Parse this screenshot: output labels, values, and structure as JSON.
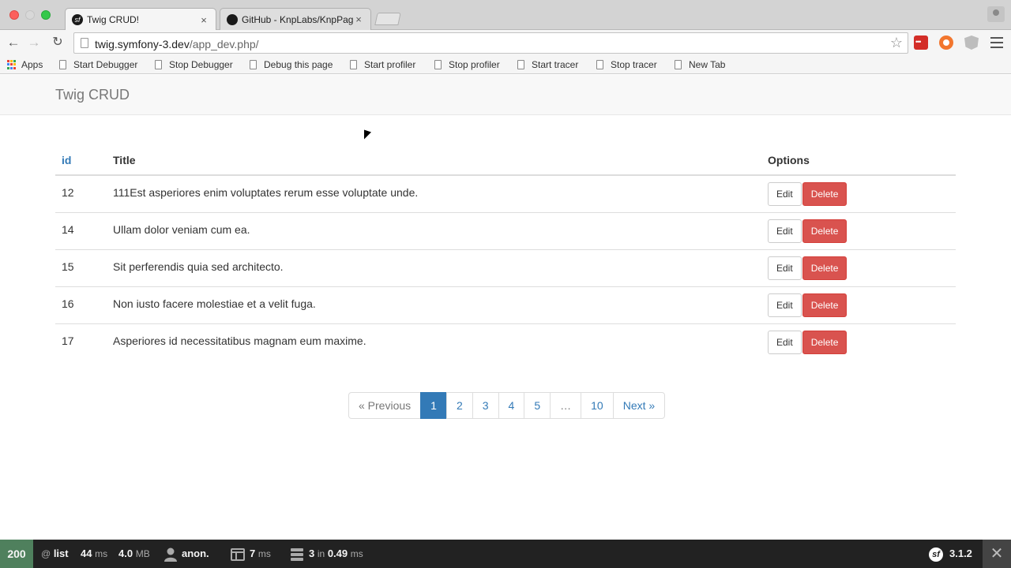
{
  "browser": {
    "tabs": [
      {
        "label": "Twig CRUD!",
        "close": "×"
      },
      {
        "label": "GitHub - KnpLabs/KnpPagi",
        "close": "×"
      }
    ],
    "url_host": "twig.symfony-3.dev",
    "url_path": "/app_dev.php/",
    "bookmarks": [
      "Apps",
      "Start Debugger",
      "Stop Debugger",
      "Debug this page",
      "Start profiler",
      "Stop profiler",
      "Start tracer",
      "Stop tracer",
      "New Tab"
    ]
  },
  "navbar": {
    "brand": "Twig CRUD"
  },
  "table": {
    "headers": {
      "id": "id",
      "title": "Title",
      "options": "Options"
    },
    "rows": [
      {
        "id": "12",
        "title": "111Est asperiores enim voluptates rerum esse voluptate unde."
      },
      {
        "id": "14",
        "title": "Ullam dolor veniam cum ea."
      },
      {
        "id": "15",
        "title": "Sit perferendis quia sed architecto."
      },
      {
        "id": "16",
        "title": "Non iusto facere molestiae et a velit fuga."
      },
      {
        "id": "17",
        "title": "Asperiores id necessitatibus magnam eum maxime."
      }
    ],
    "edit_label": "Edit",
    "delete_label": "Delete"
  },
  "pagination": {
    "previous": "« Previous",
    "pages": [
      "1",
      "2",
      "3",
      "4",
      "5",
      "…",
      "10"
    ],
    "active": "1",
    "next": "Next »"
  },
  "symfony_toolbar": {
    "status": "200",
    "route_at": "@",
    "route": "list",
    "time_value": "44",
    "time_unit": "ms",
    "memory_value": "4.0",
    "memory_unit": "MB",
    "user": "anon.",
    "twig_value": "7",
    "twig_unit": "ms",
    "db_count": "3",
    "db_in": "in",
    "db_time": "0.49",
    "db_unit": "ms",
    "version": "3.1.2",
    "close": "✕"
  },
  "colors": {
    "primary": "#337ab7",
    "danger": "#d9534f",
    "status_ok": "#4f805d",
    "toolbar_bg": "#222222"
  }
}
